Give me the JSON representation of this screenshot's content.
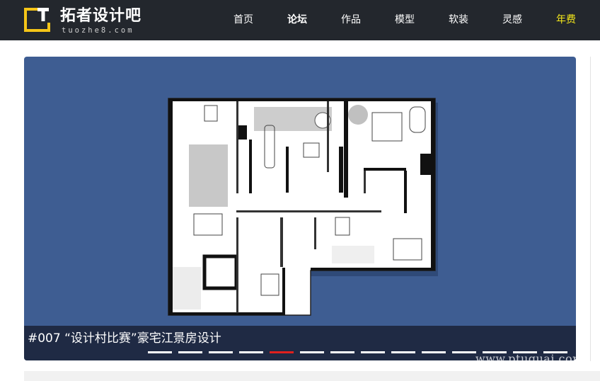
{
  "brand": {
    "title": "拓者设计吧",
    "subtitle": "tuozhe8.com",
    "mark_letter": "T",
    "accent": "#f5c518"
  },
  "nav": {
    "items": [
      {
        "label": "首页"
      },
      {
        "label": "论坛"
      },
      {
        "label": "作品"
      },
      {
        "label": "模型"
      },
      {
        "label": "软装"
      },
      {
        "label": "灵感"
      },
      {
        "label": "年费"
      }
    ],
    "highlight_color": "#f5e81a"
  },
  "slider": {
    "caption": "#007  “设计村比赛”豪宅江景房设计",
    "background": "#3e5d92",
    "slide_count": 14,
    "active_index": 4
  },
  "watermark": {
    "text": "www.ptuguai.com"
  }
}
